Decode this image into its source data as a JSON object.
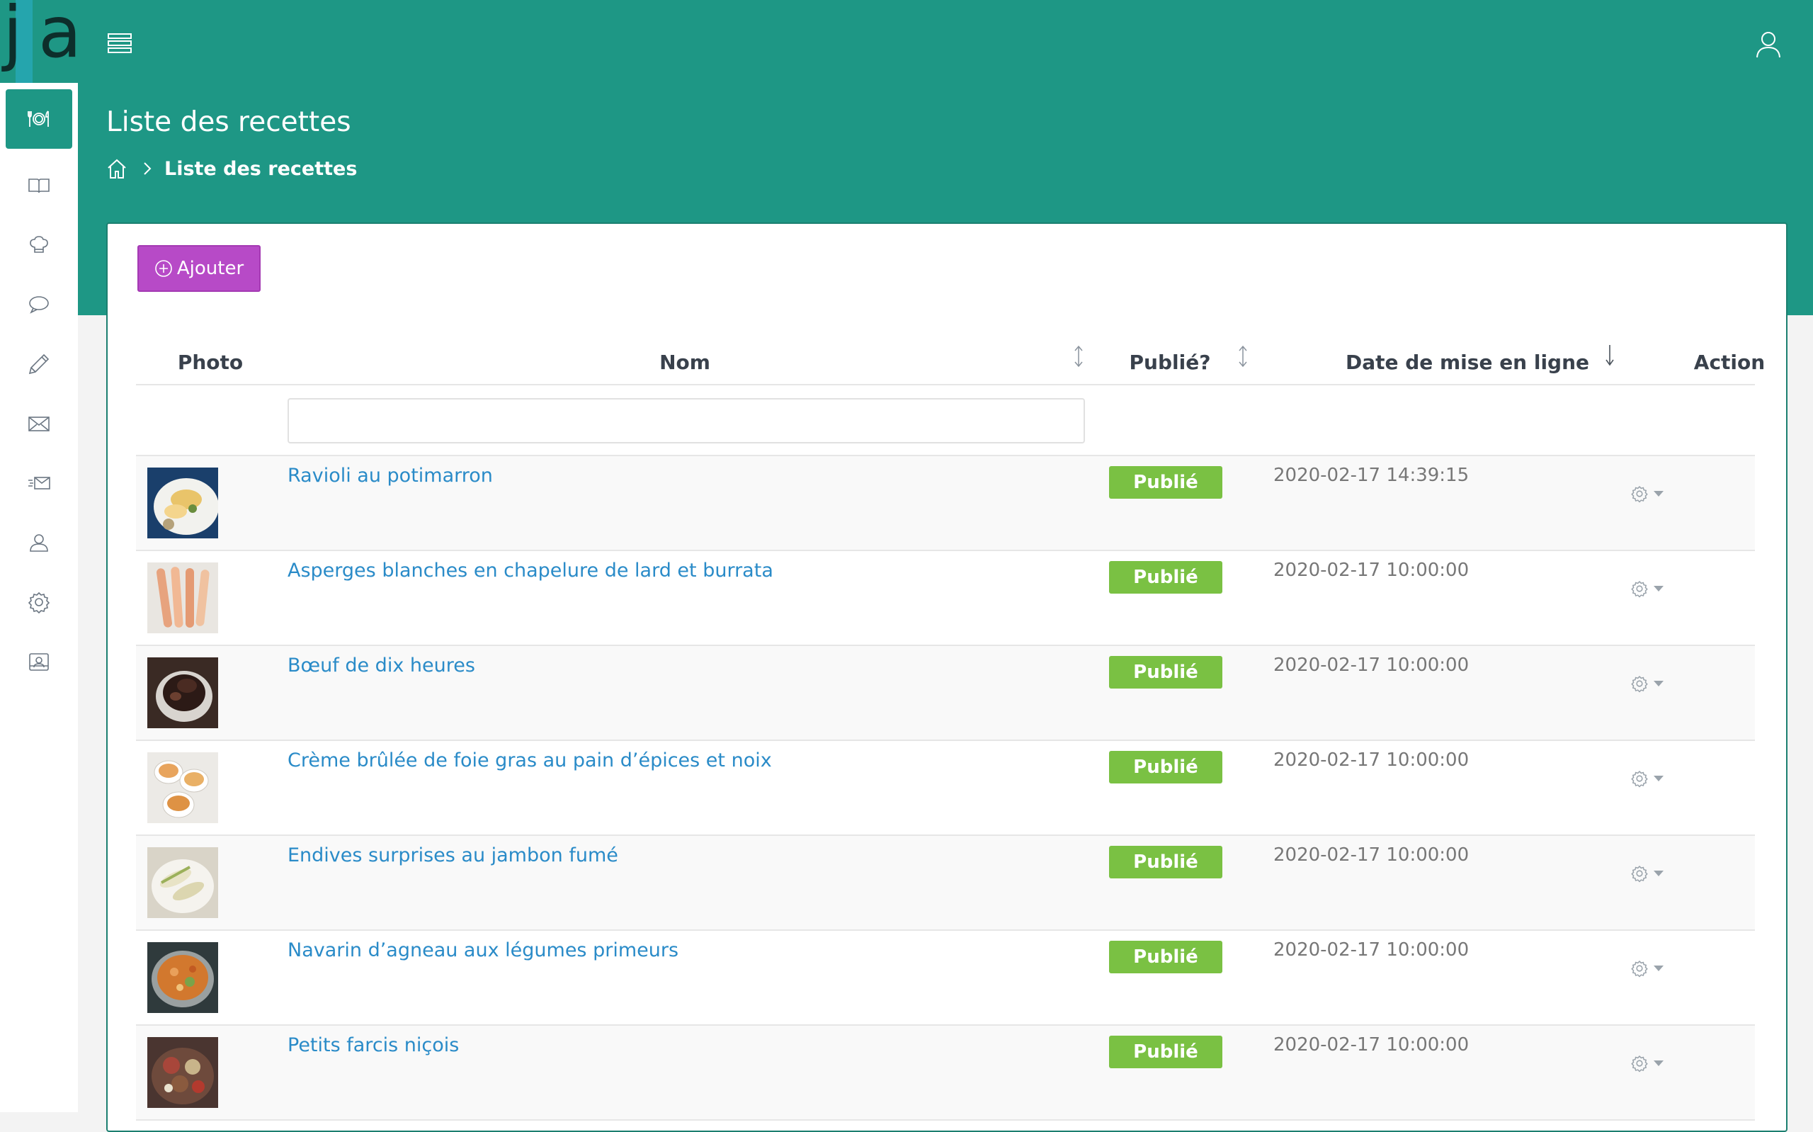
{
  "logo": {
    "letters": [
      "j",
      "a"
    ]
  },
  "colors": {
    "header": "#1e9785",
    "add_button": "#b74ac7",
    "badge": "#7ac143",
    "link": "#2a8bc8"
  },
  "header": {
    "menu_icon": "list-icon",
    "user_icon": "user-icon"
  },
  "sidebar": {
    "items": [
      {
        "icon": "dining-icon",
        "active": true
      },
      {
        "icon": "book-icon",
        "active": false
      },
      {
        "icon": "chef-hat-icon",
        "active": false
      },
      {
        "icon": "comment-icon",
        "active": false
      },
      {
        "icon": "pencil-icon",
        "active": false
      },
      {
        "icon": "mail-icon",
        "active": false
      },
      {
        "icon": "send-mail-icon",
        "active": false
      },
      {
        "icon": "users-icon",
        "active": false
      },
      {
        "icon": "gear-icon",
        "active": false
      },
      {
        "icon": "profile-card-icon",
        "active": false
      }
    ]
  },
  "page": {
    "title": "Liste des recettes",
    "breadcrumb": {
      "home_icon": "home-icon",
      "current": "Liste des recettes"
    }
  },
  "toolbar": {
    "add_label": "Ajouter",
    "add_icon": "plus-circle-icon"
  },
  "table": {
    "columns": {
      "photo": "Photo",
      "name": "Nom",
      "published": "Publié?",
      "date": "Date de mise en ligne",
      "action": "Action"
    },
    "filter": {
      "name_value": ""
    },
    "rows": [
      {
        "name": "Ravioli au potimarron",
        "status": "Publié",
        "date": "2020-02-17 14:39:15"
      },
      {
        "name": "Asperges blanches en chapelure de lard et burrata",
        "status": "Publié",
        "date": "2020-02-17 10:00:00"
      },
      {
        "name": "Bœuf de dix heures",
        "status": "Publié",
        "date": "2020-02-17 10:00:00"
      },
      {
        "name": "Crème brûlée de foie gras au pain d’épices et noix",
        "status": "Publié",
        "date": "2020-02-17 10:00:00"
      },
      {
        "name": "Endives surprises au jambon fumé",
        "status": "Publié",
        "date": "2020-02-17 10:00:00"
      },
      {
        "name": "Navarin d’agneau aux légumes primeurs",
        "status": "Publié",
        "date": "2020-02-17 10:00:00"
      },
      {
        "name": "Petits farcis niçois",
        "status": "Publié",
        "date": "2020-02-17 10:00:00"
      }
    ]
  }
}
